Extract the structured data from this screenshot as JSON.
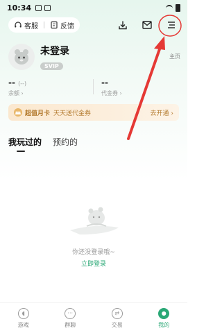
{
  "status_bar": {
    "time": "10:34"
  },
  "topbar": {
    "service_label": "客服",
    "feedback_label": "反馈"
  },
  "profile": {
    "name": "未登录",
    "badge": "SVIP",
    "homepage_label": "主页"
  },
  "stats": [
    {
      "value": "--",
      "sub": "(--)",
      "label": "余额"
    },
    {
      "value": "--",
      "label": "代金券"
    }
  ],
  "banner": {
    "title": "超值月卡",
    "subtitle": "天天送代金券",
    "action": "去开通"
  },
  "tabs": [
    {
      "label": "我玩过的",
      "active": true
    },
    {
      "label": "预约的",
      "active": false
    }
  ],
  "empty": {
    "message": "你还没登录哦~",
    "login_link": "立即登录"
  },
  "bottom_nav": [
    {
      "label": "游戏",
      "icon": "game-icon",
      "active": false
    },
    {
      "label": "群聊",
      "icon": "chat-icon",
      "active": false
    },
    {
      "label": "交易",
      "icon": "trade-icon",
      "active": false
    },
    {
      "label": "我的",
      "icon": "me-icon",
      "active": true
    }
  ],
  "colors": {
    "accent": "#2aa876",
    "annotation": "#e53935",
    "banner_text": "#b37a2d"
  }
}
